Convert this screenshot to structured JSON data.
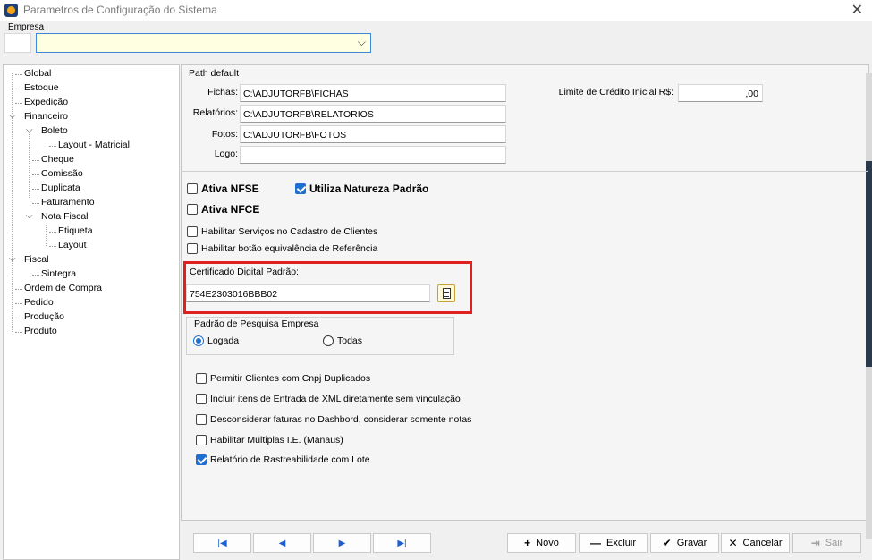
{
  "window": {
    "title": "Parametros de Configuração do Sistema"
  },
  "empresa": {
    "label": "Empresa",
    "value": ""
  },
  "tree": [
    {
      "label": "Global"
    },
    {
      "label": "Estoque"
    },
    {
      "label": "Expedição"
    },
    {
      "label": "Financeiro",
      "expanded": true
    },
    {
      "label": "Boleto",
      "expanded": true
    },
    {
      "label": "Layout - Matricial"
    },
    {
      "label": "Cheque"
    },
    {
      "label": "Comissão"
    },
    {
      "label": "Duplicata"
    },
    {
      "label": "Faturamento"
    },
    {
      "label": "Nota Fiscal",
      "expanded": true
    },
    {
      "label": "Etiqueta"
    },
    {
      "label": "Layout"
    },
    {
      "label": "Fiscal",
      "expanded": true
    },
    {
      "label": "Sintegra"
    },
    {
      "label": "Ordem de Compra"
    },
    {
      "label": "Pedido"
    },
    {
      "label": "Produção"
    },
    {
      "label": "Produto"
    }
  ],
  "path_default": {
    "title": "Path default",
    "fichas": {
      "label": "Fichas:",
      "value": "C:\\ADJUTORFB\\FICHAS"
    },
    "relatorios": {
      "label": "Relatórios:",
      "value": "C:\\ADJUTORFB\\RELATORIOS"
    },
    "fotos": {
      "label": "Fotos:",
      "value": "C:\\ADJUTORFB\\FOTOS"
    },
    "logo": {
      "label": "Logo:",
      "value": ""
    }
  },
  "limite": {
    "label": "Limite de Crédito Inicial R$:",
    "value": ",00"
  },
  "options": {
    "ativa_nfse": {
      "label": "Ativa NFSE",
      "checked": false
    },
    "utiliza_natureza": {
      "label": "Utiliza Natureza Padrão",
      "checked": true
    },
    "ativa_nfce": {
      "label": "Ativa NFCE",
      "checked": false
    },
    "habilitar_servicos": {
      "label": "Habilitar Serviços no Cadastro de Clientes",
      "checked": false
    },
    "habilitar_botao": {
      "label": "Habilitar botão equivalência de Referência",
      "checked": false
    }
  },
  "certificado": {
    "label": "Certificado Digital Padrão:",
    "value": "754E2303016BBB02"
  },
  "pesquisa": {
    "title": "Padrão de Pesquisa Empresa",
    "logada": "Logada",
    "todas": "Todas",
    "selected": "logada"
  },
  "extra": {
    "permitir_clientes": {
      "label": "Permitir Clientes com Cnpj Duplicados",
      "checked": false
    },
    "incluir_itens": {
      "label": "Incluir itens de Entrada de XML diretamente sem vinculação",
      "checked": false
    },
    "desconsiderar": {
      "label": "Desconsiderar faturas no Dashbord, considerar somente notas",
      "checked": false
    },
    "multiplas_ie": {
      "label": "Habilitar Múltiplas I.E. (Manaus)",
      "checked": false
    },
    "rastreabilidade": {
      "label": "Relatório de Rastreabilidade com Lote",
      "checked": true
    }
  },
  "buttons": {
    "novo": "Novo",
    "excluir": "Excluir",
    "gravar": "Gravar",
    "cancelar": "Cancelar",
    "sair": "Sair"
  },
  "colors": {
    "accent": "#1f6fd0",
    "highlight": "#e01f1f",
    "yellow_field": "#ffffe1"
  }
}
